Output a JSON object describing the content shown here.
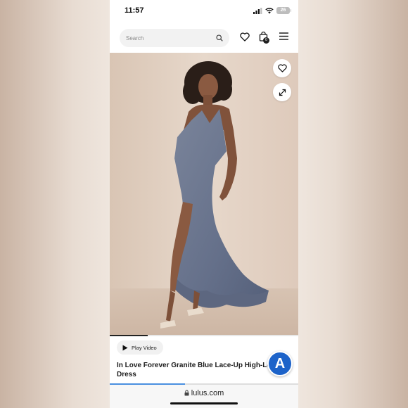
{
  "status_bar": {
    "time": "11:57",
    "battery": "26"
  },
  "header": {
    "search_placeholder": "Search",
    "bag_count": "0"
  },
  "product": {
    "image_position": {
      "current": 1,
      "fraction_shown": 0.2
    },
    "play_video_label": "Play Video",
    "title_line1": "In Love Forever Granite Blue Lace-Up High-Low",
    "title_line2": "Dress",
    "dress_color": "#6b7589"
  },
  "assistant": {
    "label": "A"
  },
  "browser": {
    "url": "lulus.com",
    "page_load_fraction": 0.4
  },
  "icons": [
    "search-icon",
    "heart-icon",
    "bag-icon",
    "menu-icon",
    "expand-icon",
    "play-icon",
    "lock-icon"
  ]
}
